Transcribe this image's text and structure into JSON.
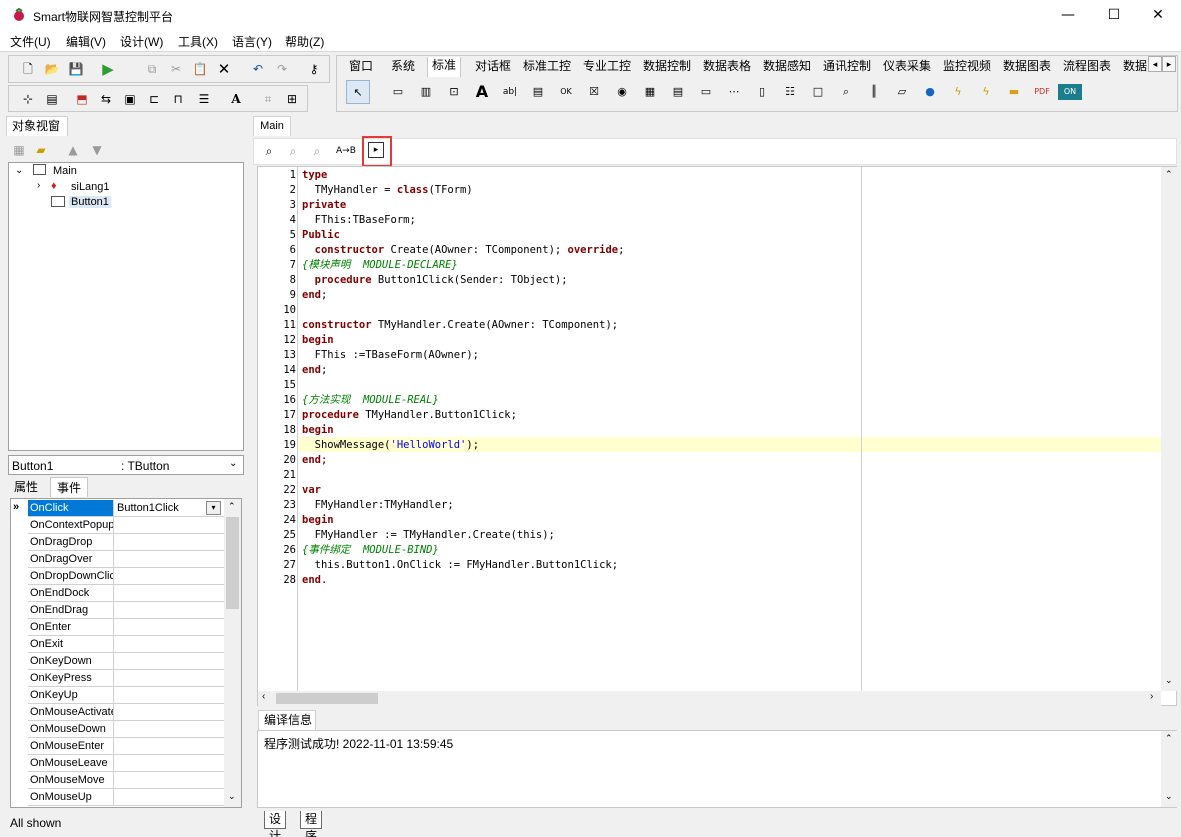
{
  "window": {
    "title": "Smart物联网智慧控制平台",
    "minimize": "—",
    "maximize": "☐",
    "close": "✕"
  },
  "menu": [
    "文件(U)",
    "编辑(V)",
    "设计(W)",
    "工具(X)",
    "语言(Y)",
    "帮助(Z)"
  ],
  "component_tabs": [
    "窗口",
    "系统",
    "标准",
    "对话框",
    "标准工控",
    "专业工控",
    "数据控制",
    "数据表格",
    "数据感知",
    "通讯控制",
    "仪表采集",
    "监控视频",
    "数据图表",
    "流程图表",
    "数据"
  ],
  "component_tab_active": "标准",
  "object_view": {
    "title": "对象视窗",
    "tree": {
      "root": "Main",
      "children": [
        "siLang1",
        "Button1"
      ]
    },
    "selected": "Button1"
  },
  "inspector": {
    "object": "Button1",
    "class": ": TButton",
    "tabs": [
      "属性",
      "事件"
    ],
    "active_tab": "事件",
    "events": [
      {
        "name": "OnClick",
        "value": "Button1Click"
      },
      {
        "name": "OnContextPopup",
        "value": ""
      },
      {
        "name": "OnDragDrop",
        "value": ""
      },
      {
        "name": "OnDragOver",
        "value": ""
      },
      {
        "name": "OnDropDownClick",
        "value": ""
      },
      {
        "name": "OnEndDock",
        "value": ""
      },
      {
        "name": "OnEndDrag",
        "value": ""
      },
      {
        "name": "OnEnter",
        "value": ""
      },
      {
        "name": "OnExit",
        "value": ""
      },
      {
        "name": "OnKeyDown",
        "value": ""
      },
      {
        "name": "OnKeyPress",
        "value": ""
      },
      {
        "name": "OnKeyUp",
        "value": ""
      },
      {
        "name": "OnMouseActivate",
        "value": ""
      },
      {
        "name": "OnMouseDown",
        "value": ""
      },
      {
        "name": "OnMouseEnter",
        "value": ""
      },
      {
        "name": "OnMouseLeave",
        "value": ""
      },
      {
        "name": "OnMouseMove",
        "value": ""
      },
      {
        "name": "OnMouseUp",
        "value": ""
      }
    ],
    "status": "All shown"
  },
  "editor": {
    "tab": "Main",
    "current_line": 19,
    "lines": [
      "type",
      "  TMyHandler = class(TForm)",
      "private",
      "  FThis:TBaseForm;",
      "Public",
      "  constructor Create(AOwner: TComponent); override;",
      "{模块声明  MODULE-DECLARE}",
      "  procedure Button1Click(Sender: TObject);",
      "end;",
      "",
      "constructor TMyHandler.Create(AOwner: TComponent);",
      "begin",
      "  FThis :=TBaseForm(AOwner);",
      "end;",
      "",
      "{方法实现  MODULE-REAL}",
      "procedure TMyHandler.Button1Click;",
      "begin",
      "  ShowMessage('HelloWorld');",
      "end;",
      "",
      "var",
      "  FMyHandler:TMyHandler;",
      "begin",
      "  FMyHandler := TMyHandler.Create(this);",
      "{事件绑定  MODULE-BIND}",
      "  this.Button1.OnClick := FMyHandler.Button1Click;",
      "end."
    ]
  },
  "output": {
    "title": "编译信息",
    "message": "程序测试成功!  2022-11-01 13:59:45"
  },
  "bottom_tabs": [
    "设计",
    "程序"
  ]
}
